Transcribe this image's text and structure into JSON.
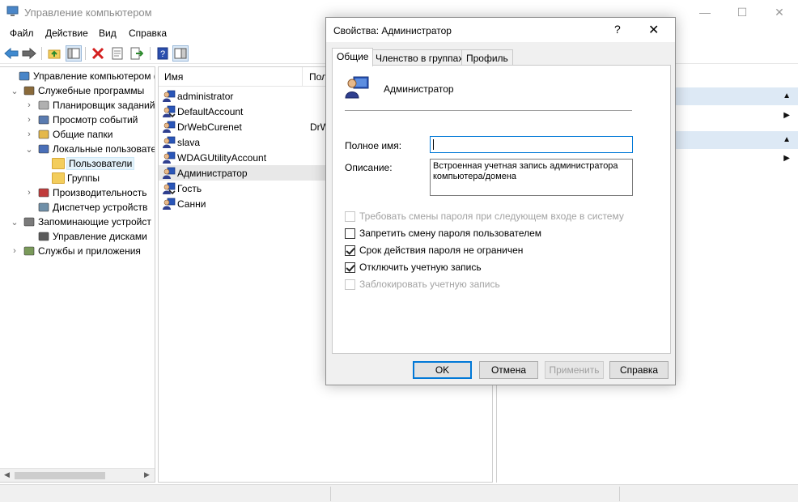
{
  "window": {
    "title": "Управление компьютером"
  },
  "menu": [
    "Файл",
    "Действие",
    "Вид",
    "Справка"
  ],
  "tree": [
    {
      "label": "Управление компьютером (л",
      "level": 0,
      "arrow": "",
      "icon": "computer-management-icon"
    },
    {
      "label": "Служебные программы",
      "level": 1,
      "arrow": "⌄",
      "icon": "tools-icon"
    },
    {
      "label": "Планировщик заданий",
      "level": 2,
      "arrow": "›",
      "icon": "clock-icon"
    },
    {
      "label": "Просмотр событий",
      "level": 2,
      "arrow": "›",
      "icon": "event-viewer-icon"
    },
    {
      "label": "Общие папки",
      "level": 2,
      "arrow": "›",
      "icon": "shared-folder-icon"
    },
    {
      "label": "Локальные пользовате",
      "level": 2,
      "arrow": "⌄",
      "icon": "users-icon"
    },
    {
      "label": "Пользователи",
      "level": 3,
      "arrow": "",
      "icon": "folder-icon",
      "selected": true
    },
    {
      "label": "Группы",
      "level": 3,
      "arrow": "",
      "icon": "folder-icon"
    },
    {
      "label": "Производительность",
      "level": 2,
      "arrow": "›",
      "icon": "performance-icon"
    },
    {
      "label": "Диспетчер устройств",
      "level": 2,
      "arrow": "",
      "icon": "device-manager-icon"
    },
    {
      "label": "Запоминающие устройст",
      "level": 1,
      "arrow": "⌄",
      "icon": "storage-icon"
    },
    {
      "label": "Управление дисками",
      "level": 2,
      "arrow": "",
      "icon": "disk-icon"
    },
    {
      "label": "Службы и приложения",
      "level": 1,
      "arrow": "›",
      "icon": "services-icon"
    }
  ],
  "list": {
    "columns": [
      "Имя",
      "Пол"
    ],
    "rows": [
      {
        "name": "administrator",
        "full": ""
      },
      {
        "name": "DefaultAccount",
        "full": ""
      },
      {
        "name": "DrWebCurenet",
        "full": "DrW"
      },
      {
        "name": "slava",
        "full": ""
      },
      {
        "name": "WDAGUtilityAccount",
        "full": ""
      },
      {
        "name": "Администратор",
        "full": "",
        "selected": true
      },
      {
        "name": "Гость",
        "full": ""
      },
      {
        "name": "Санни",
        "full": ""
      }
    ]
  },
  "dialog": {
    "title": "Свойства: Администратор",
    "help": "?",
    "close": "✕",
    "tabs": [
      "Общие",
      "Членство в группах",
      "Профиль"
    ],
    "account_name": "Администратор",
    "full_name_label": "Полное имя:",
    "full_name_value": "",
    "description_label": "Описание:",
    "description_value": "Встроенная учетная запись администратора компьютера/домена",
    "checkboxes": [
      {
        "label": "Требовать смены пароля при следующем входе в систему",
        "checked": false,
        "disabled": true
      },
      {
        "label": "Запретить смену пароля пользователем",
        "checked": false,
        "disabled": false
      },
      {
        "label": "Срок действия пароля не ограничен",
        "checked": true,
        "disabled": false
      },
      {
        "label": "Отключить учетную запись",
        "checked": true,
        "disabled": false
      },
      {
        "label": "Заблокировать учетную запись",
        "checked": false,
        "disabled": true
      }
    ],
    "buttons": {
      "ok": "OK",
      "cancel": "Отмена",
      "apply": "Применить",
      "help": "Справка"
    }
  },
  "colors": {
    "accent": "#0078d7",
    "selection": "#e5f3fb",
    "action_band": "#dde9f5"
  }
}
